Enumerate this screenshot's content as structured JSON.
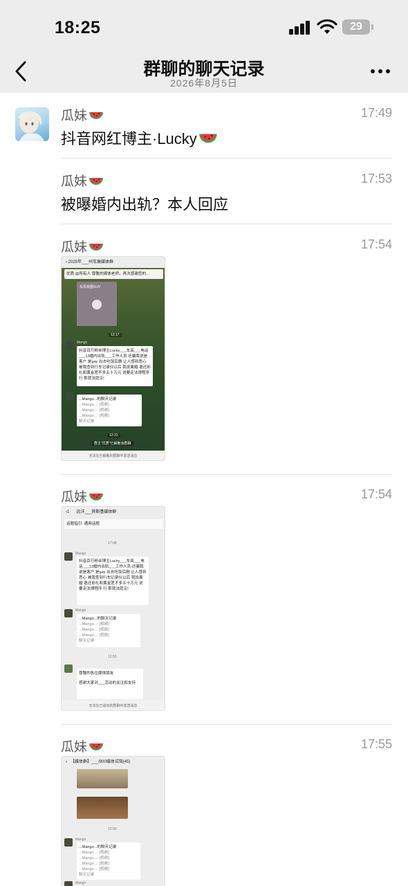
{
  "status_bar": {
    "time": "18:25",
    "battery": "29"
  },
  "header": {
    "title": "群聊的聊天记录",
    "date": "2026年8月5日"
  },
  "messages": [
    {
      "sender": "瓜妹",
      "time": "17:49",
      "text": "抖音网红博主·Lucky"
    },
    {
      "sender": "瓜妹",
      "time": "17:53",
      "text": "被曝婚内出轨？本人回应"
    },
    {
      "sender": "瓜妹",
      "time": "17:54"
    },
    {
      "sender": "瓜妹",
      "time": "17:54"
    },
    {
      "sender": "瓜妹",
      "time": "17:55"
    }
  ],
  "thumb1": {
    "title": "2025年___州车展媒体群",
    "pinned": "优质 @所有人 尊敬的媒体老师，再次感谢您的...",
    "video_label": "东风岚图SUV",
    "clock1": "12:17",
    "mango": "Mango",
    "post": "抖音百万粉丝博主Lucky___车高___电话___13婚内出轨___工作人员 还骗我说是客户 是gay 出去吃饭后删 让人感到恶心 被我查到行车记录仪以后 我说离婚 退还彩礼和黄金差不多五十万元 说要走法律程序 行 那就法庭见!",
    "record_title": "...Mango...的聊天记录",
    "record_lines": [
      "...Mango...: [视频]",
      "...Mango...: [视频]",
      "...Mango...: [视频]"
    ],
    "record_footer": "聊天记录",
    "clock2": "12:31",
    "notice": "群主\"优质\"已解散该群聊",
    "footer": "无法在已解散的群聊中发送消息"
  },
  "thumb2": {
    "title": "远洋___宾斯基媒体群",
    "topic": "话题指引: 通用话题",
    "clock1": "17:08",
    "mango": "Mango",
    "post": "抖音百万粉丝博主Lucky___车高___电话___13婚内出轨___工作人员 还骗我说是客户 是gay 出去吃饭后删 让人感到恶心 被我查到行车记录仪以后 我说离婚 退还彩礼和黄金差不多五十万元 说要走法律程序 行 那就法庭见!",
    "record_title": "...Mango...的聊天记录",
    "record_lines": [
      "...Mango...: [视频]",
      "...Mango...: [视频]",
      "...Mango...: [视频]"
    ],
    "record_footer": "聊天记录",
    "clock2": "12:53",
    "greet1": "尊敬的各位媒体朋友",
    "greet2": "感谢大家对___活动的关注和支持",
    "footer": "无法在已退出的群聊中发送消息"
  },
  "thumb3": {
    "title": "【媒体群】___/900媒体试驾(45)",
    "clock1": "12:00",
    "mango": "Mango",
    "record_title": "...Mango...的聊天记录",
    "record_lines": [
      "...Mango...: [视频]",
      "...Mango...: [视频]",
      "...Mango...: [视频]",
      "...Mango...: [视频]"
    ],
    "record_footer": "聊天记录"
  }
}
